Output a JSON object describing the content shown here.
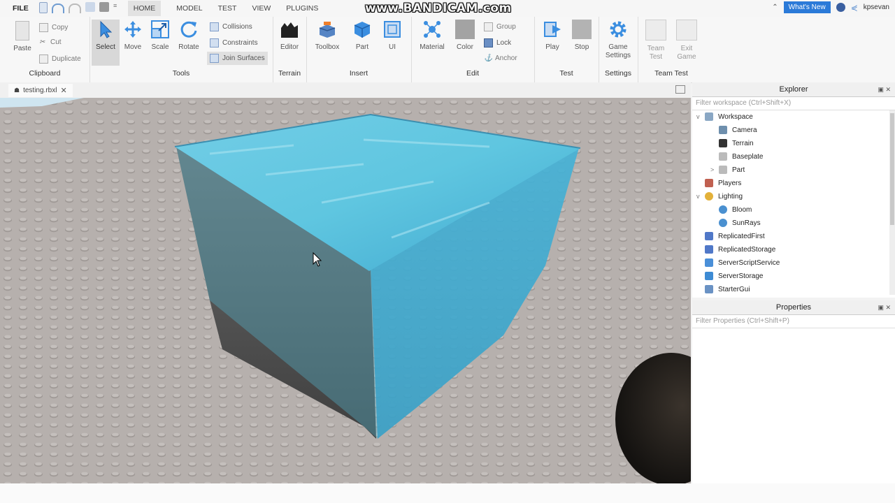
{
  "app": {
    "menu": [
      "FILE",
      "HOME",
      "MODEL",
      "TEST",
      "VIEW",
      "PLUGINS"
    ],
    "active_menu": "HOME",
    "watermark": "www.BANDICAM.com",
    "whats_new": "What's New",
    "username": "kpsevan"
  },
  "ribbon": {
    "clipboard": {
      "label": "Clipboard",
      "paste": "Paste",
      "copy": "Copy",
      "cut": "Cut",
      "duplicate": "Duplicate"
    },
    "tools": {
      "label": "Tools",
      "select": "Select",
      "move": "Move",
      "scale": "Scale",
      "rotate": "Rotate",
      "collisions": "Collisions",
      "constraints": "Constraints",
      "join_surfaces": "Join Surfaces"
    },
    "terrain": {
      "label": "Terrain",
      "editor": "Editor"
    },
    "insert": {
      "label": "Insert",
      "toolbox": "Toolbox",
      "part": "Part",
      "ui": "UI"
    },
    "edit": {
      "label": "Edit",
      "material": "Material",
      "color": "Color",
      "group": "Group",
      "lock": "Lock",
      "anchor": "Anchor"
    },
    "test": {
      "label": "Test",
      "play": "Play",
      "stop": "Stop"
    },
    "settings": {
      "label": "Settings",
      "game_settings": "Game Settings"
    },
    "team_test": {
      "label": "Team Test",
      "team_test": "Team Test",
      "exit_game": "Exit Game"
    }
  },
  "document_tab": {
    "label": "testing.rbxl"
  },
  "explorer": {
    "title": "Explorer",
    "filter_placeholder": "Filter workspace (Ctrl+Shift+X)",
    "items": [
      {
        "label": "Workspace",
        "icon": "workspace-icon",
        "color": "#8aa7c4",
        "toggle": "v"
      },
      {
        "label": "Camera",
        "icon": "camera-icon",
        "color": "#6e8fad",
        "toggle": ""
      },
      {
        "label": "Terrain",
        "icon": "terrain-icon",
        "color": "#333333",
        "toggle": ""
      },
      {
        "label": "Baseplate",
        "icon": "part-icon",
        "color": "#bbbbbb",
        "toggle": ""
      },
      {
        "label": "Part",
        "icon": "part-icon",
        "color": "#bbbbbb",
        "toggle": ">"
      },
      {
        "label": "Players",
        "icon": "players-icon",
        "color": "#c06050",
        "toggle": ""
      },
      {
        "label": "Lighting",
        "icon": "lighting-icon",
        "color": "#e3b13a",
        "toggle": "v"
      },
      {
        "label": "Bloom",
        "icon": "effect-icon",
        "color": "#4a90d0",
        "toggle": ""
      },
      {
        "label": "SunRays",
        "icon": "effect-icon",
        "color": "#4a90d0",
        "toggle": ""
      },
      {
        "label": "ReplicatedFirst",
        "icon": "replicated-icon",
        "color": "#5078c8",
        "toggle": ""
      },
      {
        "label": "ReplicatedStorage",
        "icon": "replicated-icon",
        "color": "#5078c8",
        "toggle": ""
      },
      {
        "label": "ServerScriptService",
        "icon": "script-service-icon",
        "color": "#4a8fd8",
        "toggle": ""
      },
      {
        "label": "ServerStorage",
        "icon": "storage-icon",
        "color": "#3d8bd4",
        "toggle": ""
      },
      {
        "label": "StarterGui",
        "icon": "gui-icon",
        "color": "#6a92c4",
        "toggle": ""
      }
    ]
  },
  "properties": {
    "title": "Properties",
    "filter_placeholder": "Filter Properties (Ctrl+Shift+P)"
  },
  "viewport": {
    "colors": {
      "ground": "#b3adaa",
      "water_top": "#5fc6e0",
      "water_side": "#3fa8cc",
      "terrain_dark": "#4c4c4c",
      "sky": "#cfe5f0"
    }
  }
}
